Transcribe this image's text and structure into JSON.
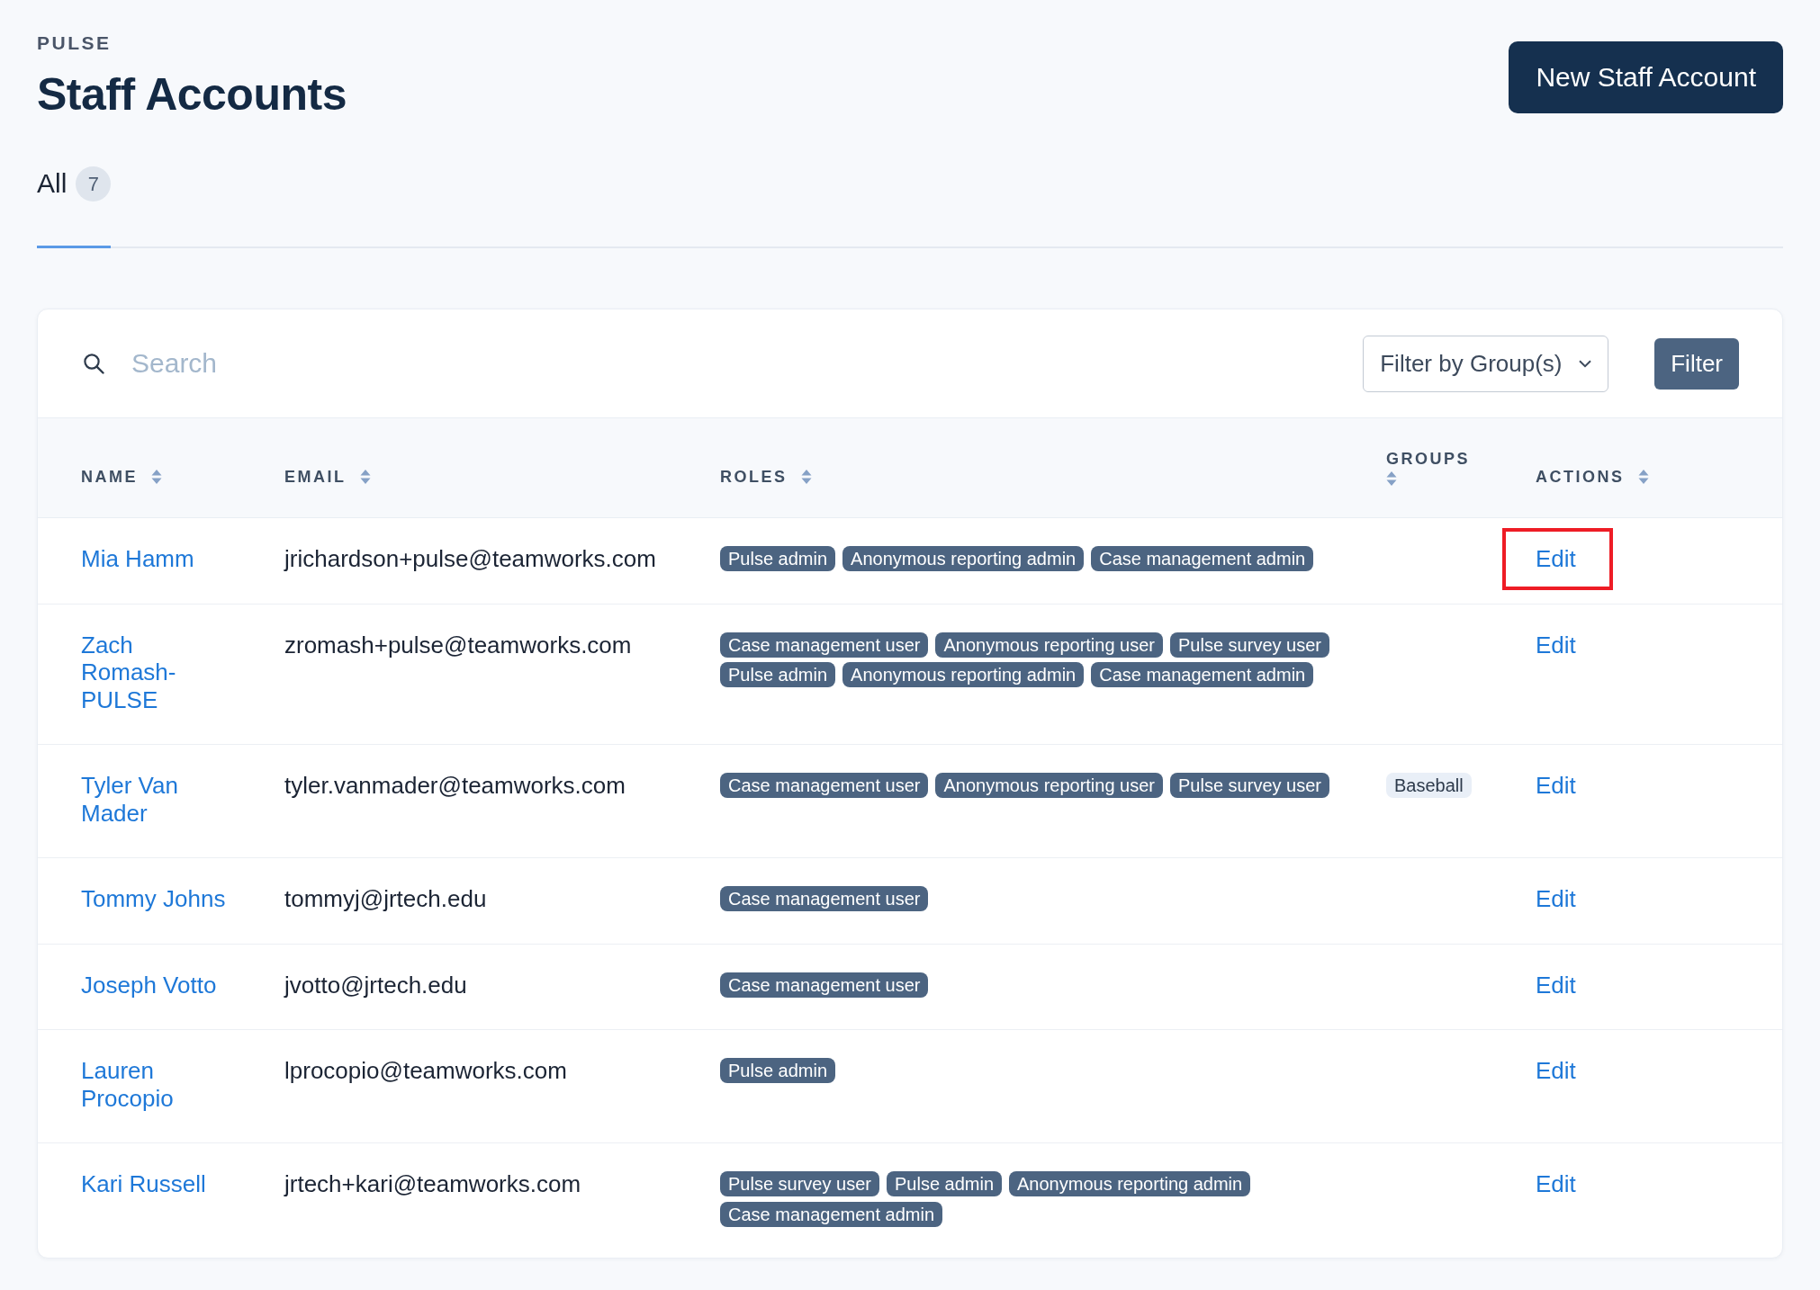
{
  "app": {
    "label": "PULSE",
    "title": "Staff Accounts",
    "primary_button": "New Staff Account"
  },
  "tabs": [
    {
      "label": "All",
      "count": "7",
      "selected": true
    }
  ],
  "search": {
    "placeholder": "Search"
  },
  "group_filter": {
    "label": "Filter by Group(s)"
  },
  "filter_button": "Filter",
  "table": {
    "columns": [
      {
        "label": "NAME",
        "sortable": true
      },
      {
        "label": "EMAIL",
        "sortable": true
      },
      {
        "label": "ROLES",
        "sortable": true
      },
      {
        "label": "GROUPS",
        "sortable": true
      },
      {
        "label": "ACTIONS",
        "sortable": true
      }
    ],
    "rows": [
      {
        "name": "Mia Hamm",
        "email": "jrichardson+pulse@teamworks.com",
        "roles": [
          "Pulse admin",
          "Anonymous reporting admin",
          "Case management admin"
        ],
        "action": "Edit",
        "highlighted": true
      },
      {
        "name": "Zach Romash-PULSE",
        "email": "zromash+pulse@teamworks.com",
        "roles": [
          "Case management user",
          "Anonymous reporting user",
          "Pulse survey user",
          "Pulse admin",
          "Anonymous reporting admin",
          "Case management admin"
        ],
        "action": "Edit",
        "highlighted": false
      },
      {
        "name": "Tyler Van Mader",
        "email": "tyler.vanmader@teamworks.com",
        "roles": [
          "Case management user",
          "Anonymous reporting user",
          "Pulse survey user"
        ],
        "groups": [
          "Baseball"
        ],
        "action": "Edit",
        "highlighted": false
      },
      {
        "name": "Tommy Johns",
        "email": "tommyj@jrtech.edu",
        "roles": [
          "Case management user"
        ],
        "action": "Edit",
        "highlighted": false
      },
      {
        "name": "Joseph Votto",
        "email": "jvotto@jrtech.edu",
        "roles": [
          "Case management user"
        ],
        "action": "Edit",
        "highlighted": false
      },
      {
        "name": "Lauren Procopio",
        "email": "lprocopio@teamworks.com",
        "roles": [
          "Pulse admin"
        ],
        "action": "Edit",
        "highlighted": false
      },
      {
        "name": "Kari Russell",
        "email": "jrtech+kari@teamworks.com",
        "roles": [
          "Pulse survey user",
          "Pulse admin",
          "Anonymous reporting admin",
          "Case management admin"
        ],
        "action": "Edit",
        "highlighted": false
      }
    ]
  }
}
